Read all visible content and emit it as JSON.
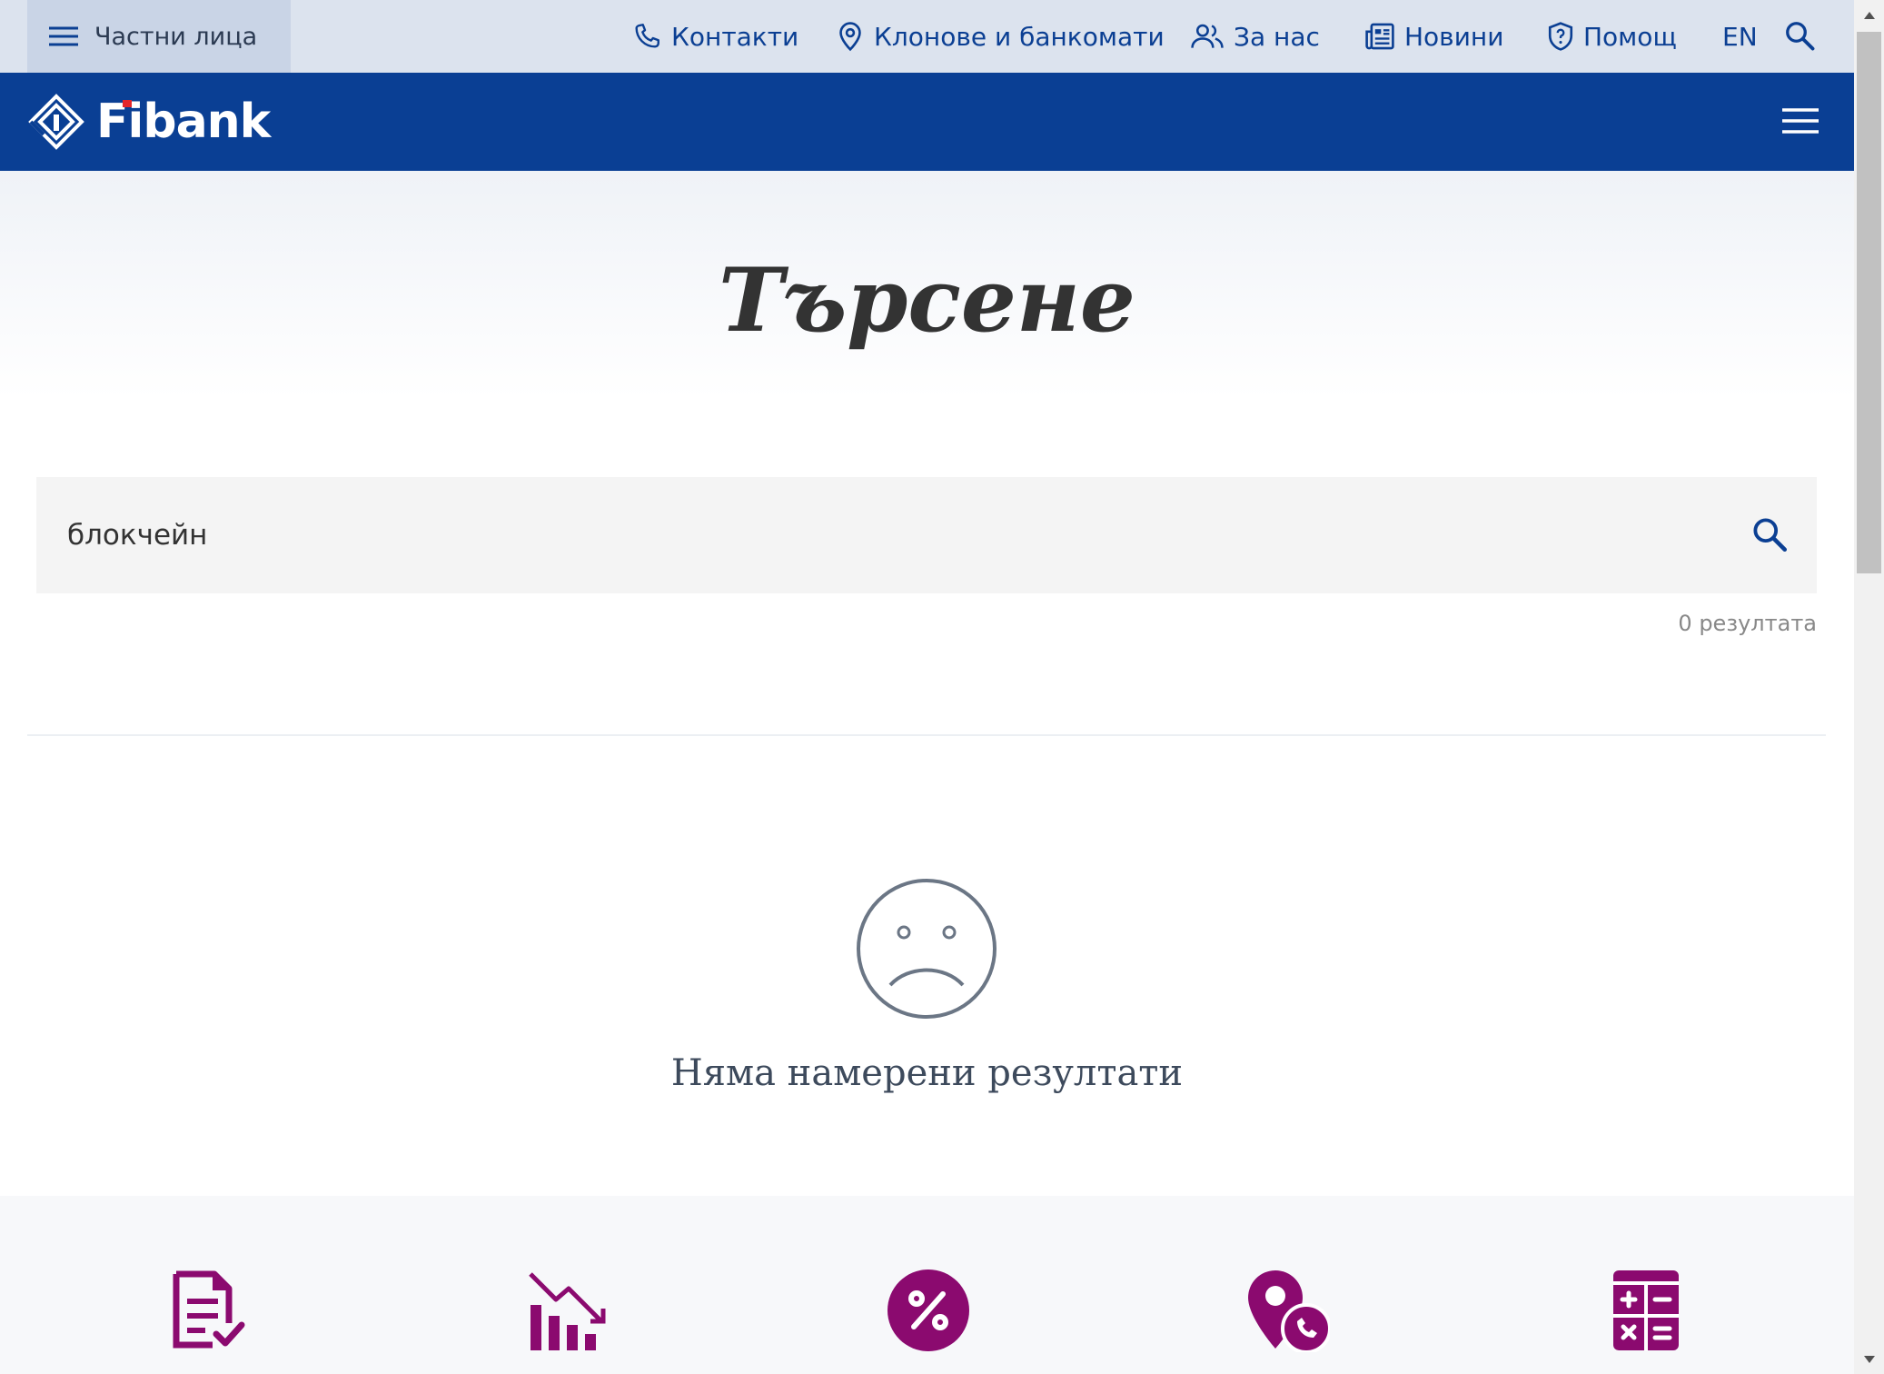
{
  "topbar": {
    "segment_label": "Частни лица",
    "items": [
      {
        "label": "Контакти",
        "icon": "phone-icon"
      },
      {
        "label": "Клонове и банкомати",
        "icon": "location-pin-icon"
      },
      {
        "label": "За нас",
        "icon": "users-icon"
      },
      {
        "label": "Новини",
        "icon": "newspaper-icon"
      },
      {
        "label": "Помощ",
        "icon": "shield-question-icon"
      }
    ],
    "language": "EN"
  },
  "header": {
    "logo_text": "Fibank"
  },
  "page": {
    "title": "Търсене"
  },
  "search": {
    "value": "блокчейн",
    "results_count": "0 резултата"
  },
  "empty_state": {
    "message": "Няма намерени резултати"
  },
  "quick_links": [
    {
      "icon": "document-check-icon"
    },
    {
      "icon": "chart-decline-icon"
    },
    {
      "icon": "percent-icon"
    },
    {
      "icon": "location-phone-icon"
    },
    {
      "icon": "calculator-icon"
    }
  ],
  "colors": {
    "brand_blue": "#0a3f94",
    "topbar_bg": "#dce3ee",
    "accent_purple": "#8b0a6f"
  }
}
